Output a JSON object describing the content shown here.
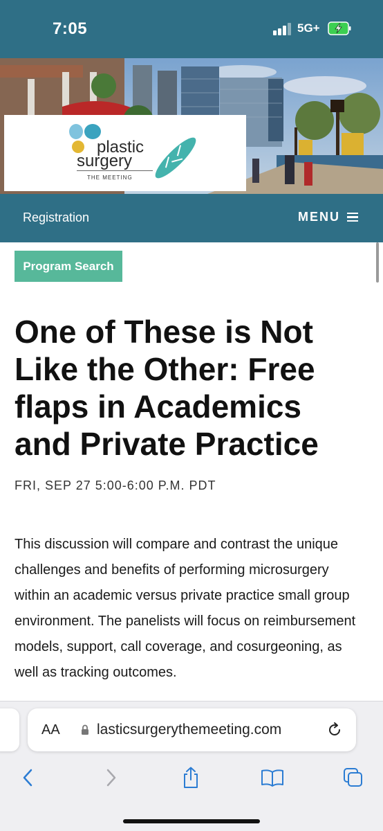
{
  "status_bar": {
    "time": "7:05",
    "network": "5G+",
    "background_color": "#2f6f86"
  },
  "logo": {
    "line1": "plastic",
    "line2": "surgery",
    "tagline": "THE MEETING"
  },
  "nav": {
    "registration_label": "Registration",
    "menu_label": "MENU",
    "menu_icon": "hamburger-icon"
  },
  "content": {
    "tag_button": "Program Search",
    "title": "One of These is Not Like the Other: Free flaps in Academics and Private Practice",
    "date": "FRI, SEP 27 5:00-6:00 P.M. PDT",
    "description": "This discussion will compare and contrast the unique challenges and benefits of performing microsurgery within an academic versus private practice small group environment. The panelists will focus on reimbursement models, support, call coverage, and cosurgeoning, as well as tracking outcomes."
  },
  "browser": {
    "text_size_button": "AA",
    "url": "lasticsurgerythemeeting.com",
    "icons": [
      "back-icon",
      "forward-icon",
      "share-icon",
      "bookmarks-icon",
      "tabs-icon",
      "reload-icon",
      "lock-icon"
    ]
  },
  "colors": {
    "brand_teal": "#2f6f86",
    "program_green": "#57b89a"
  }
}
